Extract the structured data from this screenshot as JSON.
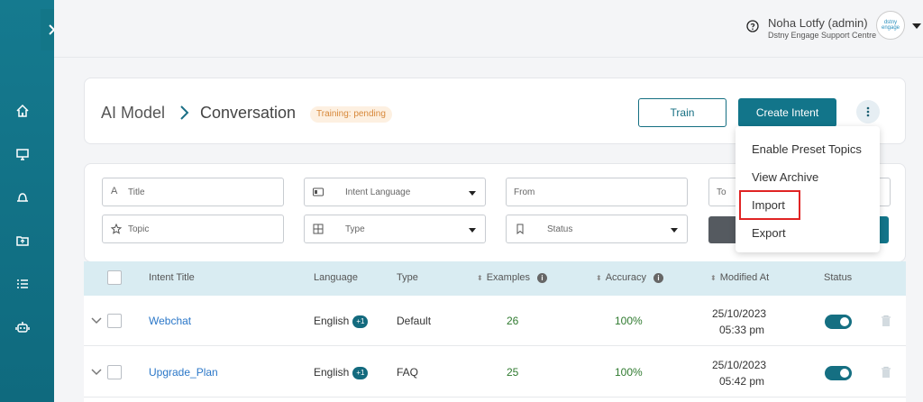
{
  "header": {
    "user_name": "Noha Lotfy (admin)",
    "user_org": "Dstny Engage Support Centre",
    "avatar_text": "dstny engage"
  },
  "breadcrumb": {
    "root": "AI Model",
    "current": "Conversation"
  },
  "training_badge": "Training: pending",
  "actions": {
    "train": "Train",
    "create_intent": "Create Intent"
  },
  "filters": {
    "title": "Title",
    "intent_language": "Intent Language",
    "from": "From",
    "to": "To",
    "topic": "Topic",
    "type": "Type",
    "status": "Status"
  },
  "menu": {
    "items": [
      "Enable Preset Topics",
      "View Archive",
      "Import",
      "Export"
    ]
  },
  "table": {
    "columns": {
      "intent_title": "Intent Title",
      "language": "Language",
      "type": "Type",
      "examples": "Examples",
      "accuracy": "Accuracy",
      "modified_at": "Modified At",
      "status": "Status"
    },
    "rows": [
      {
        "title": "Webchat",
        "language": "English",
        "lang_extra": "+1",
        "type": "Default",
        "examples": "26",
        "accuracy": "100%",
        "date": "25/10/2023",
        "time": "05:33 pm",
        "enabled": true
      },
      {
        "title": "Upgrade_Plan",
        "language": "English",
        "lang_extra": "+1",
        "type": "FAQ",
        "examples": "25",
        "accuracy": "100%",
        "date": "25/10/2023",
        "time": "05:42 pm",
        "enabled": true
      }
    ]
  },
  "colors": {
    "sidebar": "#157a8f",
    "accent": "#12758a",
    "badge_bg": "#fdf0e1",
    "badge_text": "#d7883a",
    "highlight": "#e02424"
  }
}
